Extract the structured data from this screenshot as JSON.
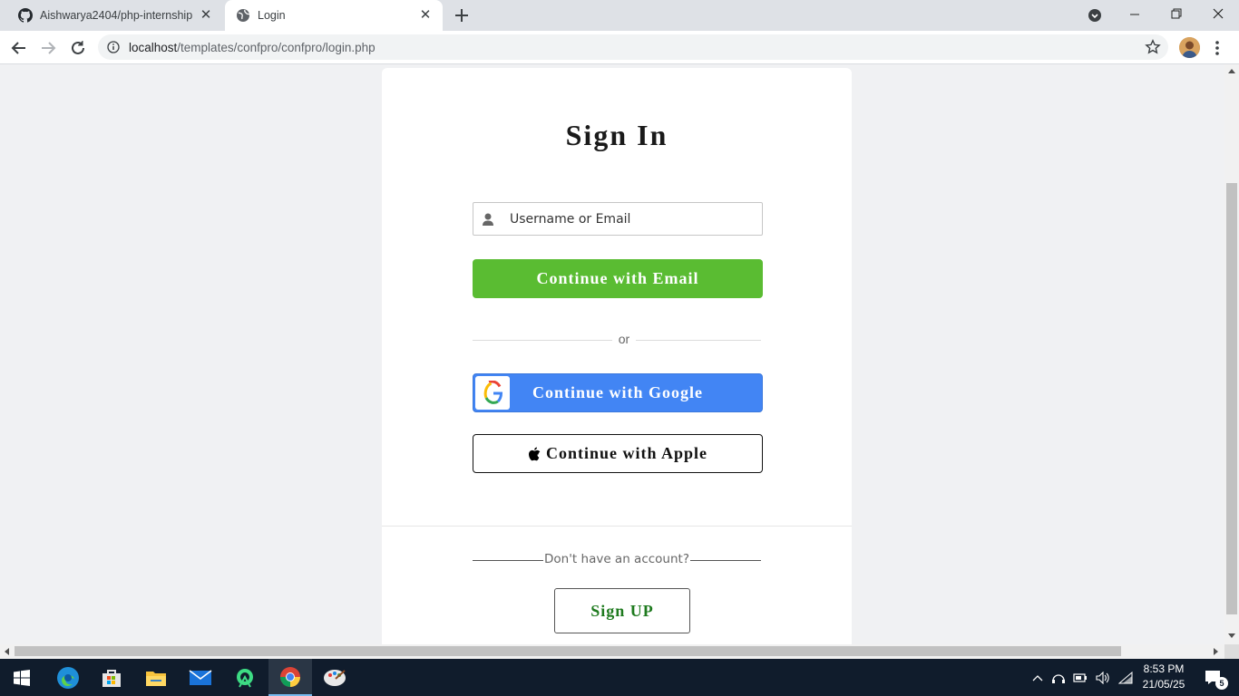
{
  "browser": {
    "tabs": [
      {
        "title": "Aishwarya2404/php-internship",
        "icon": "github-icon",
        "active": false
      },
      {
        "title": "Login",
        "icon": "globe-icon",
        "active": true
      }
    ],
    "url_host": "localhost",
    "url_path": "/templates/confpro/confpro/login.php"
  },
  "login": {
    "title": "Sign In",
    "username_placeholder": "Username or Email",
    "email_button": "Continue with Email",
    "divider_text": "or",
    "google_button": "Continue with Google",
    "apple_button": "Continue with Apple",
    "no_account_text": "Don't have an account?",
    "signup_button": "Sign UP"
  },
  "colors": {
    "email_button": "#5abc32",
    "google_button": "#4285f4",
    "signup_text": "#1e7a1e",
    "page_background": "#f0f1f3"
  },
  "taskbar": {
    "apps": [
      "windows-start",
      "edge",
      "store",
      "file-explorer",
      "mail",
      "android-studio",
      "chrome",
      "paint"
    ],
    "time": "8:53 PM",
    "date": "21/05/25",
    "notification_count": "5"
  }
}
